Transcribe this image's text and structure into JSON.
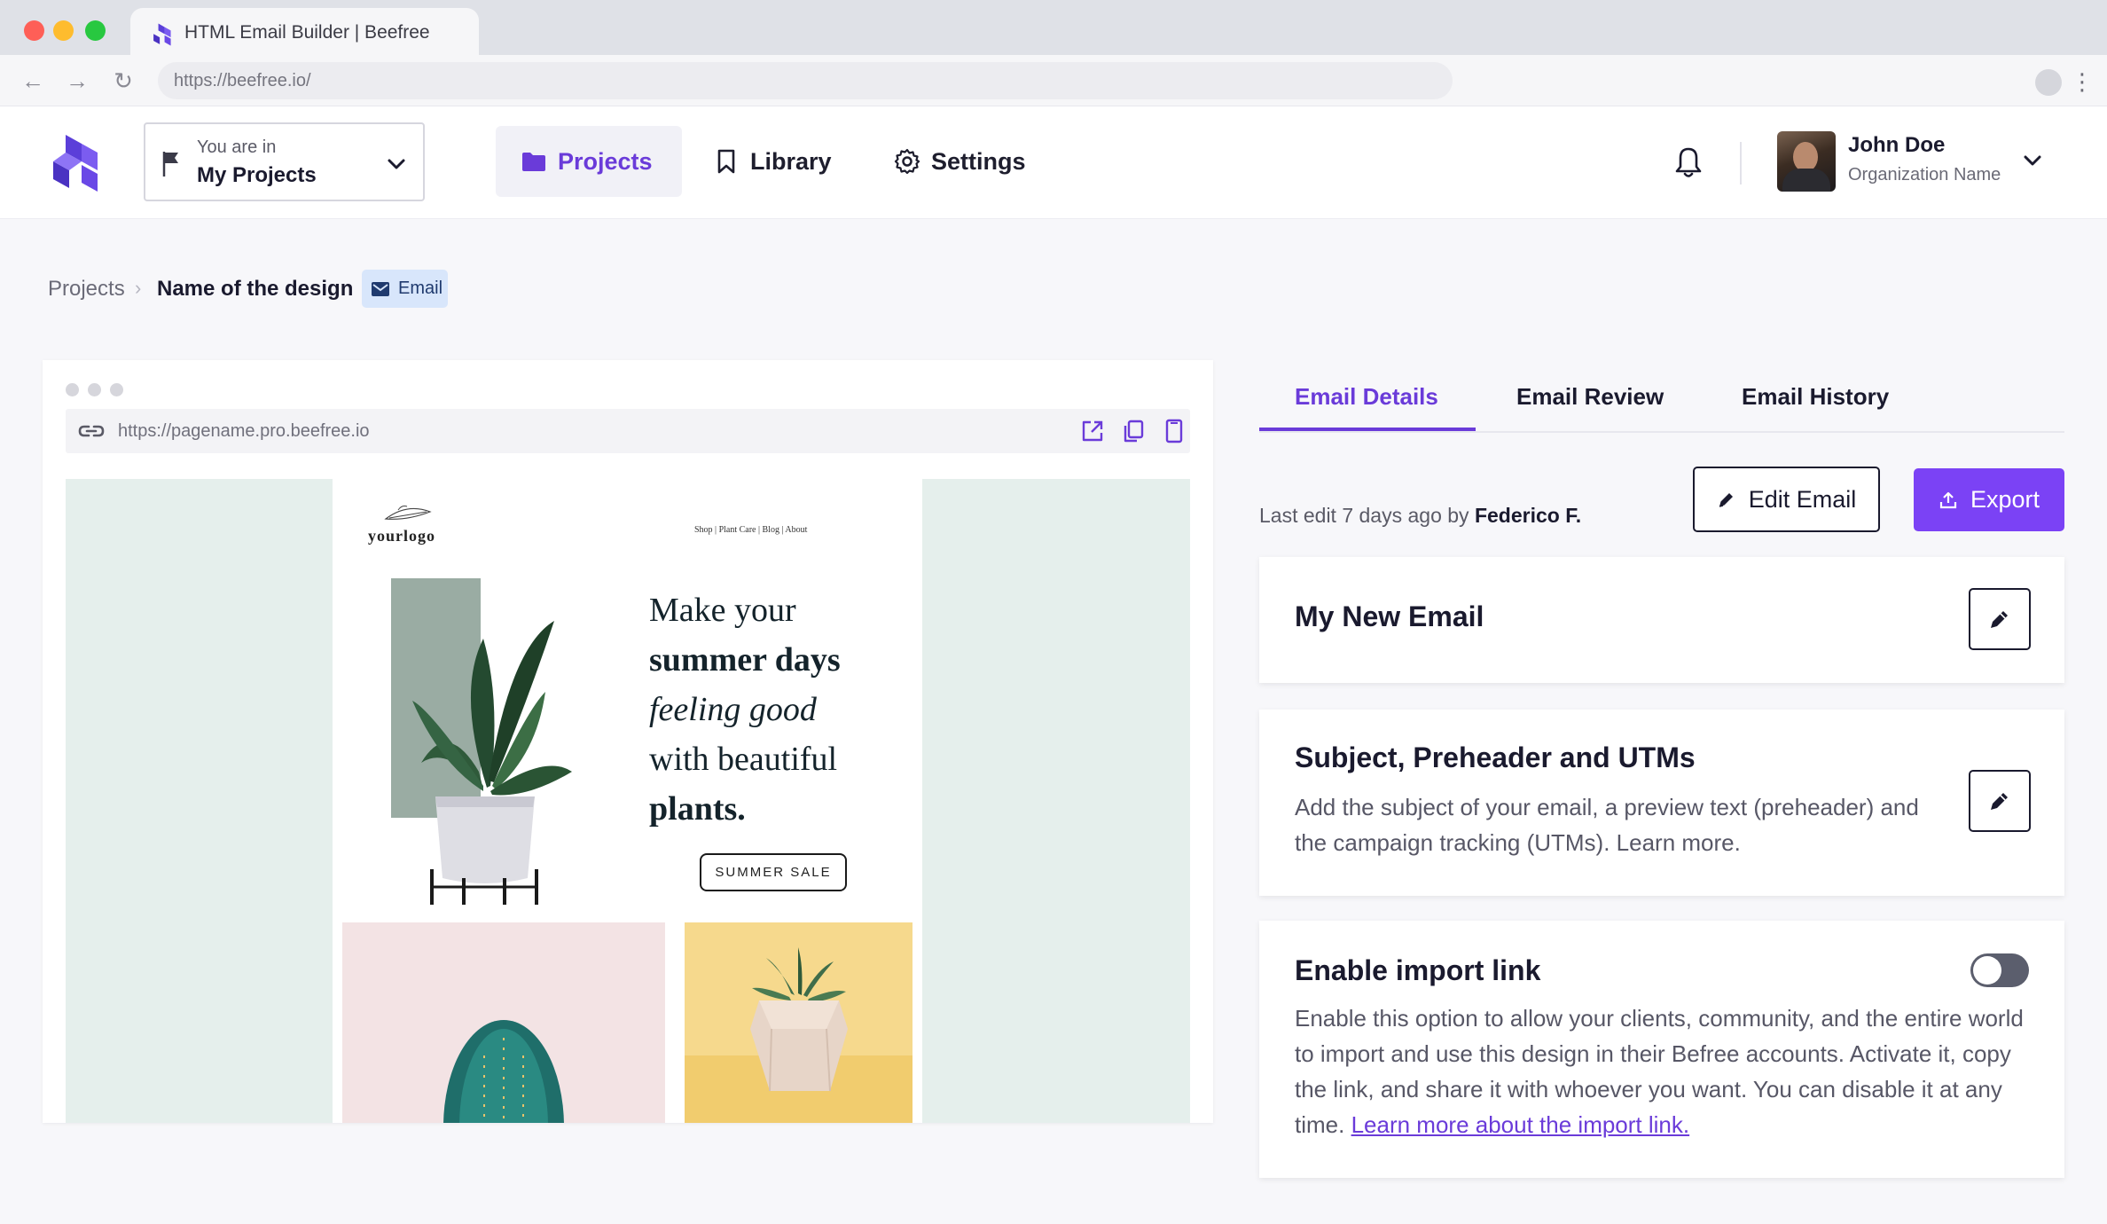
{
  "browser": {
    "tab_title": "HTML Email Builder | Beefree",
    "url": "https://beefree.io/"
  },
  "header": {
    "workspace_label": "You are in",
    "workspace_name": "My Projects",
    "nav": {
      "projects": "Projects",
      "library": "Library",
      "settings": "Settings"
    },
    "user": {
      "name": "John Doe",
      "organization": "Organization Name"
    }
  },
  "breadcrumb": {
    "root": "Projects",
    "current": "Name of the design",
    "badge": "Email"
  },
  "preview": {
    "url": "https://pagename.pro.beefree.io",
    "email": {
      "logo": "yourlogo",
      "menu": "Shop  |  Plant Care  |  Blog  |  About",
      "headline": {
        "line1": "Make your",
        "line2": "summer days",
        "line3": "feeling good",
        "line4": "with beautiful",
        "line5": "plants."
      },
      "cta": "SUMMER SALE"
    }
  },
  "details": {
    "tabs": [
      "Email Details",
      "Email Review",
      "Email History"
    ],
    "last_edit_prefix": "Last edit 7 days ago by",
    "last_edit_user": "Federico F.",
    "edit_button": "Edit Email",
    "export_button": "Export",
    "cards": {
      "name": {
        "title": "My New Email"
      },
      "subject": {
        "title": "Subject, Preheader and UTMs",
        "description": "Add the subject of your email, a preview text (preheader) and the campaign tracking (UTMs). Learn more."
      },
      "import": {
        "title": "Enable import link",
        "description": "Enable this option to allow your clients, community, and the entire world to import and use this design in their Befree accounts. Activate it, copy the link, and share it with whoever you want. You can disable it at any time.",
        "link": "Learn more about the import link.",
        "enabled": false
      }
    }
  },
  "colors": {
    "accent": "#6a3bd9",
    "export": "#7b42f5",
    "canvas": "#e5efec"
  }
}
